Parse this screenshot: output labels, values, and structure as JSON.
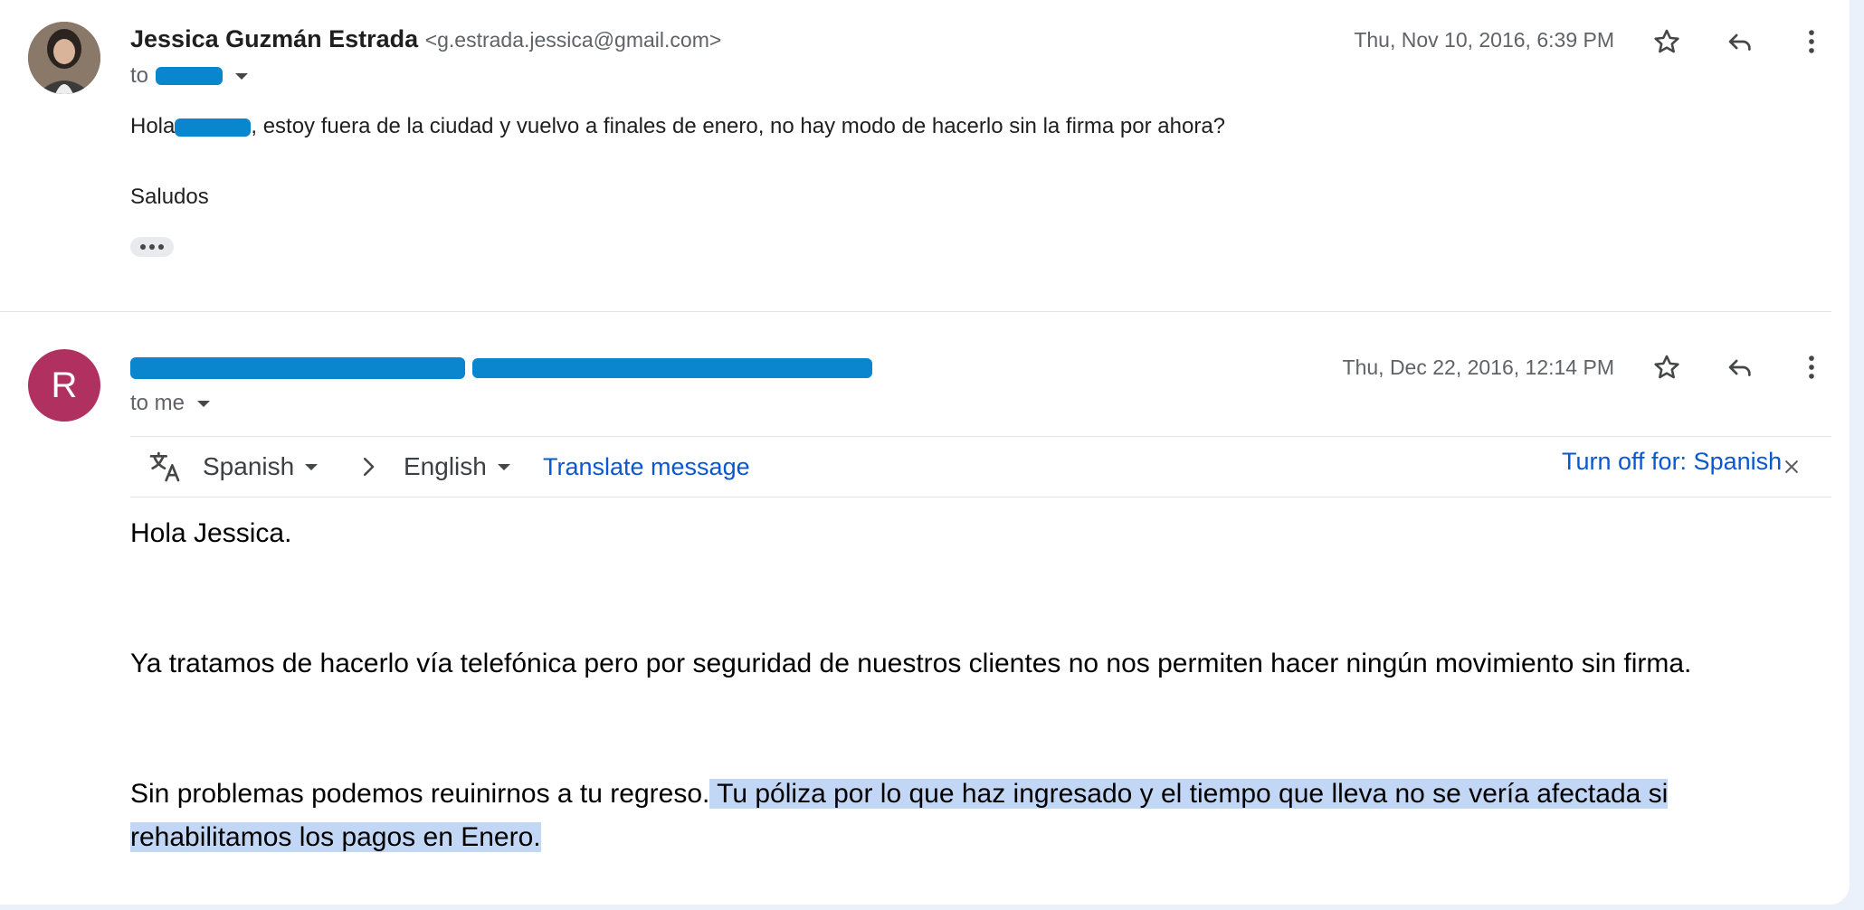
{
  "messages": [
    {
      "sender_name": "Jessica Guzmán Estrada",
      "sender_email": "<g.estrada.jessica@gmail.com>",
      "to_label": "to",
      "date": "Thu, Nov 10, 2016, 6:39 PM",
      "greeting": "Hola",
      "body_line": ", estoy fuera de la ciudad y vuelvo a finales de enero, no hay modo de hacerlo sin la firma por ahora?",
      "closing": "Saludos"
    },
    {
      "avatar_letter": "R",
      "to_label": "to me",
      "date": "Thu, Dec 22, 2016, 12:14 PM",
      "translate": {
        "source_lang": "Spanish",
        "target_lang": "English",
        "translate_link": "Translate message",
        "turn_off": "Turn off for: Spanish"
      },
      "greeting": "Hola Jessica.",
      "paragraph1": "Ya tratamos de hacerlo vía telefónica pero por seguridad de nuestros clientes no nos permiten hacer ningún movimiento sin firma.",
      "paragraph2_plain": "Sin problemas podemos reuinirnos a tu regreso.",
      "paragraph2_highlight_a": " Tu póliza por lo que haz ingresado y el tiempo que lleva no se vería afectada si",
      "paragraph2_highlight_b": "rehabilitamos los pagos en Enero."
    }
  ],
  "icons": {
    "star": "star-icon",
    "reply": "reply-icon",
    "more": "more-vert-icon",
    "translate": "translate-icon",
    "arrow": "chevron-right-icon",
    "close": "close-icon"
  },
  "colors": {
    "avatar_r": "#b0305f",
    "link": "#0b57d0",
    "highlight": "#c2d7f5",
    "redaction": "#0a86cf"
  }
}
